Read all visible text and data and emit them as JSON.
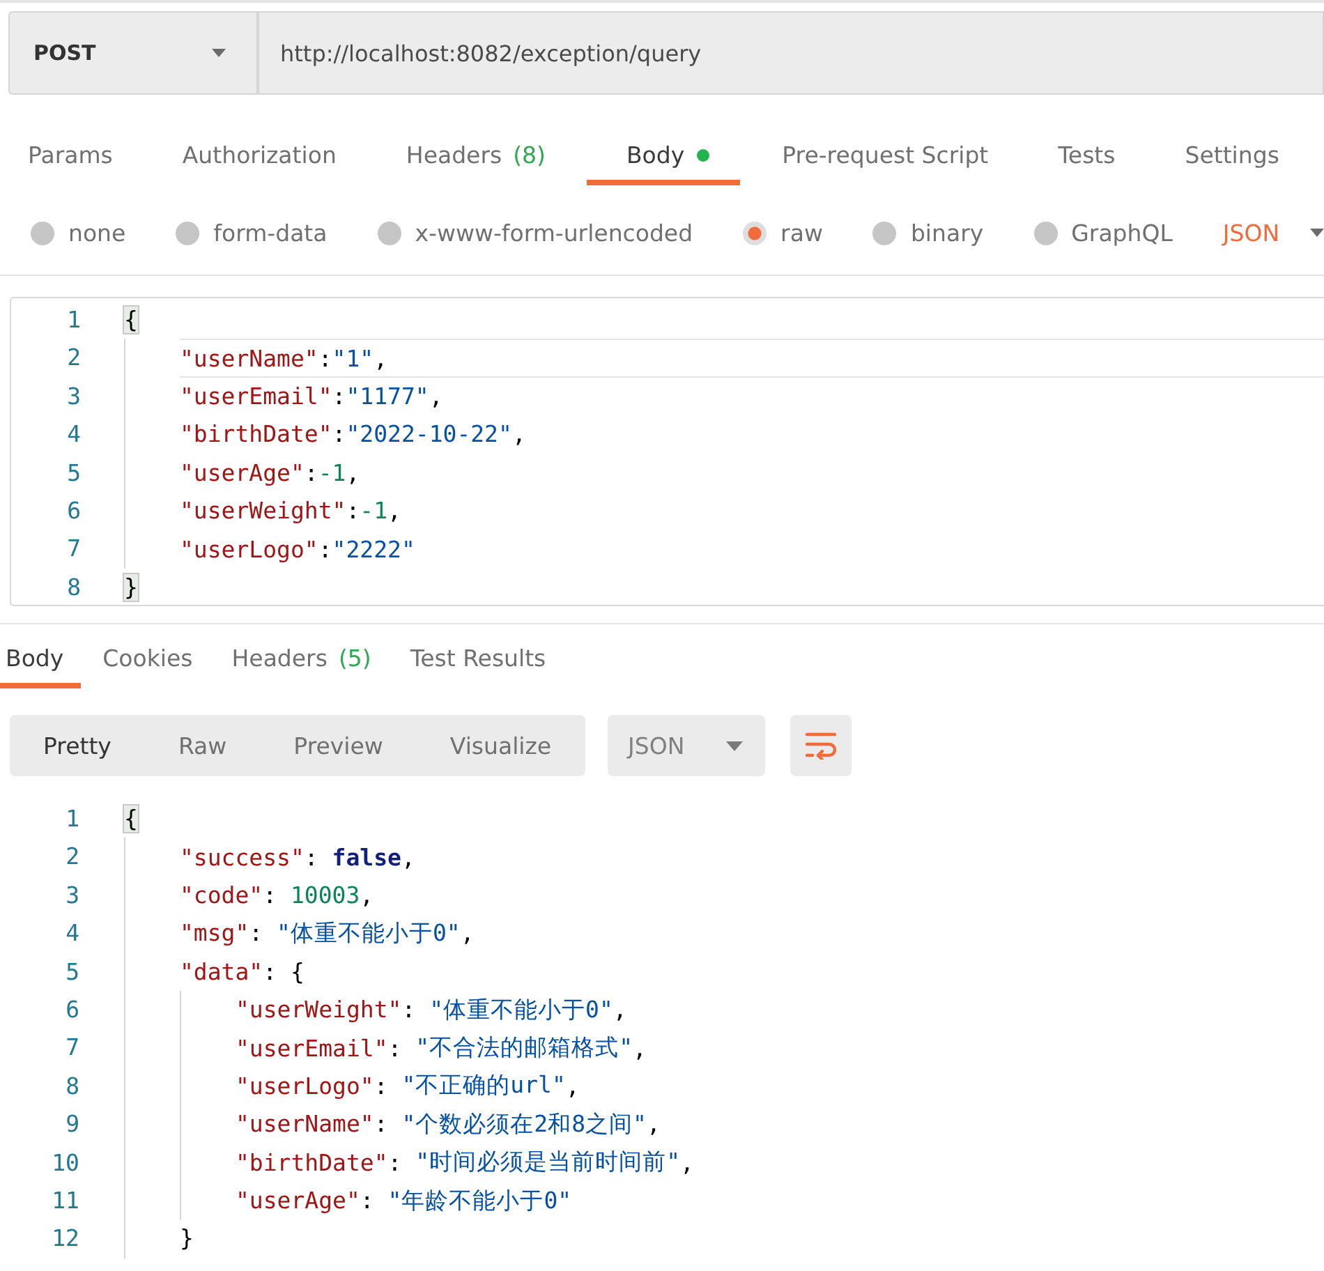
{
  "request": {
    "method": "POST",
    "url": "http://localhost:8082/exception/query"
  },
  "request_tabs": [
    {
      "label": "Params",
      "selected": false,
      "dot": false
    },
    {
      "label": "Authorization",
      "selected": false,
      "dot": false
    },
    {
      "label": "Headers",
      "count": "(8)",
      "selected": false,
      "dot": false
    },
    {
      "label": "Body",
      "selected": true,
      "dot": true
    },
    {
      "label": "Pre-request Script",
      "selected": false,
      "dot": false
    },
    {
      "label": "Tests",
      "selected": false,
      "dot": false
    },
    {
      "label": "Settings",
      "selected": false,
      "dot": false
    }
  ],
  "body_types": [
    {
      "label": "none",
      "selected": false
    },
    {
      "label": "form-data",
      "selected": false
    },
    {
      "label": "x-www-form-urlencoded",
      "selected": false
    },
    {
      "label": "raw",
      "selected": true
    },
    {
      "label": "binary",
      "selected": false
    },
    {
      "label": "GraphQL",
      "selected": false
    }
  ],
  "body_format": "JSON",
  "request_body": {
    "lines": [
      {
        "number": "1",
        "active": false,
        "tokens": [
          {
            "kind": "matched_brace",
            "text": "{"
          }
        ],
        "children": [
          {
            "number": "2",
            "active": true,
            "tokens": [
              {
                "kind": "key",
                "text": "\"userName\""
              },
              {
                "kind": "punct",
                "text": ":"
              },
              {
                "kind": "string",
                "text": "\"1\""
              },
              {
                "kind": "punct",
                "text": ","
              }
            ]
          },
          {
            "number": "3",
            "active": false,
            "tokens": [
              {
                "kind": "key",
                "text": "\"userEmail\""
              },
              {
                "kind": "punct",
                "text": ":"
              },
              {
                "kind": "string",
                "text": "\"1177\""
              },
              {
                "kind": "punct",
                "text": ","
              }
            ]
          },
          {
            "number": "4",
            "active": false,
            "tokens": [
              {
                "kind": "key",
                "text": "\"birthDate\""
              },
              {
                "kind": "punct",
                "text": ":"
              },
              {
                "kind": "string",
                "text": "\"2022-10-22\""
              },
              {
                "kind": "punct",
                "text": ","
              }
            ]
          },
          {
            "number": "5",
            "active": false,
            "tokens": [
              {
                "kind": "key",
                "text": "\"userAge\""
              },
              {
                "kind": "punct",
                "text": ":"
              },
              {
                "kind": "number",
                "text": "-1"
              },
              {
                "kind": "punct",
                "text": ","
              }
            ]
          },
          {
            "number": "6",
            "active": false,
            "tokens": [
              {
                "kind": "key",
                "text": "\"userWeight\""
              },
              {
                "kind": "punct",
                "text": ":"
              },
              {
                "kind": "number",
                "text": "-1"
              },
              {
                "kind": "punct",
                "text": ","
              }
            ]
          },
          {
            "number": "7",
            "active": false,
            "tokens": [
              {
                "kind": "key",
                "text": "\"userLogo\""
              },
              {
                "kind": "punct",
                "text": ":"
              },
              {
                "kind": "string",
                "text": "\"2222\""
              }
            ]
          }
        ]
      },
      {
        "number": "8",
        "active": false,
        "tokens": [
          {
            "kind": "matched_brace",
            "text": "}"
          }
        ]
      }
    ]
  },
  "response_tabs": [
    {
      "label": "Body",
      "selected": true
    },
    {
      "label": "Cookies",
      "selected": false
    },
    {
      "label": "Headers",
      "count": "(5)",
      "selected": false
    },
    {
      "label": "Test Results",
      "selected": false
    }
  ],
  "view_modes": [
    {
      "label": "Pretty",
      "selected": true
    },
    {
      "label": "Raw",
      "selected": false
    },
    {
      "label": "Preview",
      "selected": false
    },
    {
      "label": "Visualize",
      "selected": false
    }
  ],
  "response_format": "JSON",
  "response_body": {
    "lines": [
      {
        "number": "1",
        "tokens": [
          {
            "kind": "matched_brace",
            "text": "{"
          }
        ],
        "children": [
          {
            "number": "2",
            "tokens": [
              {
                "kind": "key",
                "text": "\"success\""
              },
              {
                "kind": "punct",
                "text": ": "
              },
              {
                "kind": "bool",
                "text": "false"
              },
              {
                "kind": "punct",
                "text": ","
              }
            ]
          },
          {
            "number": "3",
            "tokens": [
              {
                "kind": "key",
                "text": "\"code\""
              },
              {
                "kind": "punct",
                "text": ": "
              },
              {
                "kind": "number",
                "text": "10003"
              },
              {
                "kind": "punct",
                "text": ","
              }
            ]
          },
          {
            "number": "4",
            "tokens": [
              {
                "kind": "key",
                "text": "\"msg\""
              },
              {
                "kind": "punct",
                "text": ": "
              },
              {
                "kind": "string",
                "text": "\"体重不能小于0\""
              },
              {
                "kind": "punct",
                "text": ","
              }
            ]
          },
          {
            "number": "5",
            "tokens": [
              {
                "kind": "key",
                "text": "\"data\""
              },
              {
                "kind": "punct",
                "text": ": {"
              }
            ],
            "children": [
              {
                "number": "6",
                "tokens": [
                  {
                    "kind": "key",
                    "text": "\"userWeight\""
                  },
                  {
                    "kind": "punct",
                    "text": ": "
                  },
                  {
                    "kind": "string",
                    "text": "\"体重不能小于0\""
                  },
                  {
                    "kind": "punct",
                    "text": ","
                  }
                ]
              },
              {
                "number": "7",
                "tokens": [
                  {
                    "kind": "key",
                    "text": "\"userEmail\""
                  },
                  {
                    "kind": "punct",
                    "text": ": "
                  },
                  {
                    "kind": "string",
                    "text": "\"不合法的邮箱格式\""
                  },
                  {
                    "kind": "punct",
                    "text": ","
                  }
                ]
              },
              {
                "number": "8",
                "tokens": [
                  {
                    "kind": "key",
                    "text": "\"userLogo\""
                  },
                  {
                    "kind": "punct",
                    "text": ": "
                  },
                  {
                    "kind": "string",
                    "text": "\"不正确的url\""
                  },
                  {
                    "kind": "punct",
                    "text": ","
                  }
                ]
              },
              {
                "number": "9",
                "tokens": [
                  {
                    "kind": "key",
                    "text": "\"userName\""
                  },
                  {
                    "kind": "punct",
                    "text": ": "
                  },
                  {
                    "kind": "string",
                    "text": "\"个数必须在2和8之间\""
                  },
                  {
                    "kind": "punct",
                    "text": ","
                  }
                ]
              },
              {
                "number": "10",
                "tokens": [
                  {
                    "kind": "key",
                    "text": "\"birthDate\""
                  },
                  {
                    "kind": "punct",
                    "text": ": "
                  },
                  {
                    "kind": "string",
                    "text": "\"时间必须是当前时间前\""
                  },
                  {
                    "kind": "punct",
                    "text": ","
                  }
                ]
              },
              {
                "number": "11",
                "tokens": [
                  {
                    "kind": "key",
                    "text": "\"userAge\""
                  },
                  {
                    "kind": "punct",
                    "text": ": "
                  },
                  {
                    "kind": "string",
                    "text": "\"年龄不能小于0\""
                  }
                ]
              }
            ]
          },
          {
            "number": "12",
            "tokens": [
              {
                "kind": "punct",
                "text": "}"
              }
            ]
          }
        ]
      }
    ]
  }
}
